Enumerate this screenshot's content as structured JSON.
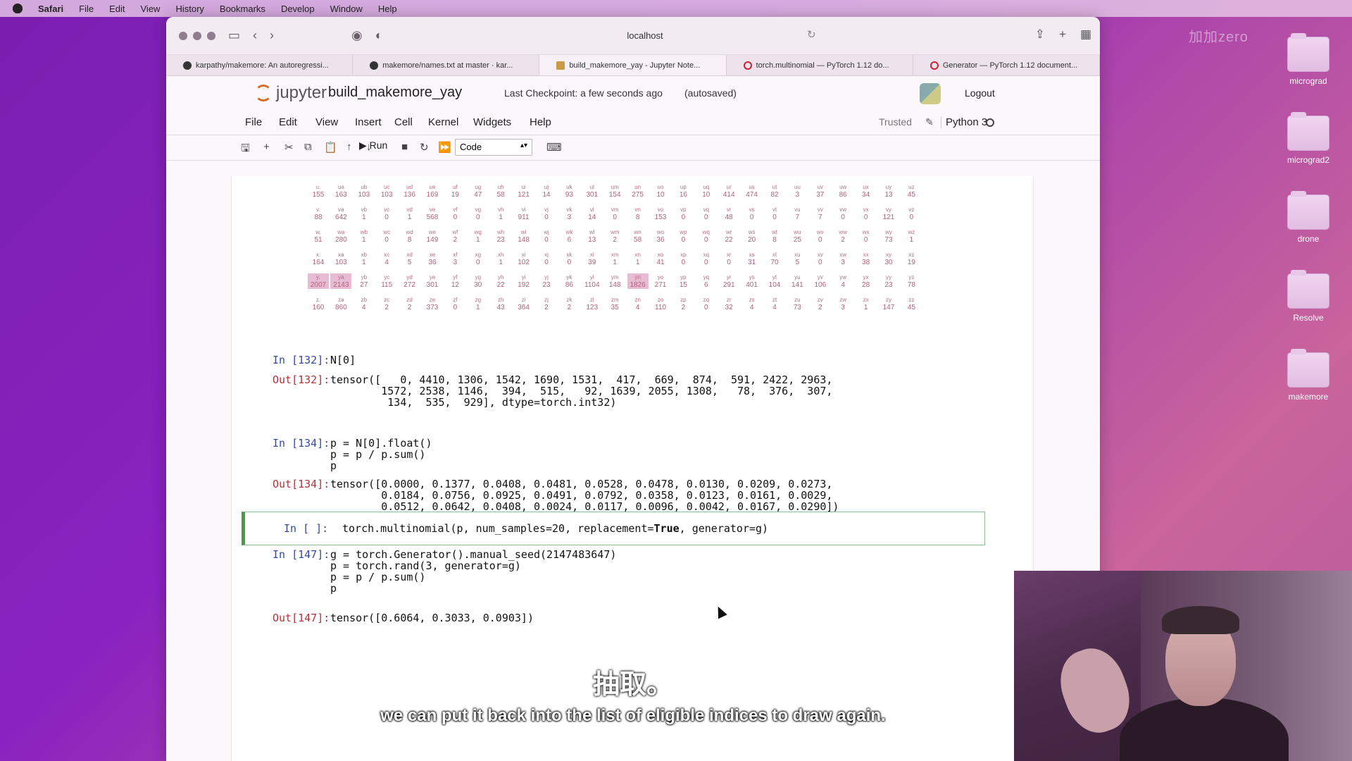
{
  "menubar": {
    "app": "Safari",
    "items": [
      "File",
      "Edit",
      "View",
      "History",
      "Bookmarks",
      "Develop",
      "Window",
      "Help"
    ]
  },
  "desktop": {
    "watermark": "加加zero",
    "icons": [
      "micrograd",
      "micrograd2",
      "drone",
      "Resolve",
      "makemore"
    ]
  },
  "browser": {
    "url": "localhost",
    "tabs": [
      {
        "label": "karpathy/makemore: An autoregressi...",
        "icon": "github-icon"
      },
      {
        "label": "makemore/names.txt at master · kar...",
        "icon": "github-icon"
      },
      {
        "label": "build_makemore_yay - Jupyter Note...",
        "icon": "jupyter-icon"
      },
      {
        "label": "torch.multinomial — PyTorch 1.12 do...",
        "icon": "pytorch-icon"
      },
      {
        "label": "Generator — PyTorch 1.12 document...",
        "icon": "pytorch-icon"
      }
    ],
    "active_tab": 2
  },
  "jupyter": {
    "logo_text": "jupyter",
    "notebook_name": "build_makemore_yay",
    "checkpoint": "Last Checkpoint: a few seconds ago",
    "autosaved": "(autosaved)",
    "logout": "Logout",
    "menu": [
      "File",
      "Edit",
      "View",
      "Insert",
      "Cell",
      "Kernel",
      "Widgets",
      "Help"
    ],
    "trusted": "Trusted",
    "kernel": "Python 3",
    "run_label": "Run",
    "cell_type": "Code"
  },
  "bigram_grid": {
    "rows": [
      {
        "labels": [
          "u.",
          "ua",
          "ub",
          "uc",
          "ud",
          "ue",
          "uf",
          "ug",
          "uh",
          "ui",
          "uj",
          "uk",
          "ul",
          "um",
          "un",
          "uo",
          "up",
          "uq",
          "ur",
          "us",
          "ut",
          "uu",
          "uv",
          "uw",
          "ux",
          "uy",
          "uz"
        ],
        "values": [
          "155",
          "163",
          "103",
          "103",
          "136",
          "169",
          "19",
          "47",
          "58",
          "121",
          "14",
          "93",
          "301",
          "154",
          "275",
          "10",
          "16",
          "10",
          "414",
          "474",
          "82",
          "3",
          "37",
          "86",
          "34",
          "13",
          "45"
        ]
      },
      {
        "labels": [
          "v.",
          "va",
          "vb",
          "vc",
          "vd",
          "ve",
          "vf",
          "vg",
          "vh",
          "vi",
          "vj",
          "vk",
          "vl",
          "vm",
          "vn",
          "vo",
          "vp",
          "vq",
          "vr",
          "vs",
          "vt",
          "vu",
          "vv",
          "vw",
          "vx",
          "vy",
          "vz"
        ],
        "values": [
          "88",
          "642",
          "1",
          "0",
          "1",
          "568",
          "0",
          "0",
          "1",
          "911",
          "0",
          "3",
          "14",
          "0",
          "8",
          "153",
          "0",
          "0",
          "48",
          "0",
          "0",
          "7",
          "7",
          "0",
          "0",
          "121",
          "0"
        ]
      },
      {
        "labels": [
          "w.",
          "wa",
          "wb",
          "wc",
          "wd",
          "we",
          "wf",
          "wg",
          "wh",
          "wi",
          "wj",
          "wk",
          "wl",
          "wm",
          "wn",
          "wo",
          "wp",
          "wq",
          "wr",
          "ws",
          "wt",
          "wu",
          "wv",
          "ww",
          "wx",
          "wy",
          "wz"
        ],
        "values": [
          "51",
          "280",
          "1",
          "0",
          "8",
          "149",
          "2",
          "1",
          "23",
          "148",
          "0",
          "6",
          "13",
          "2",
          "58",
          "36",
          "0",
          "0",
          "22",
          "20",
          "8",
          "25",
          "0",
          "2",
          "0",
          "73",
          "1"
        ]
      },
      {
        "labels": [
          "x.",
          "xa",
          "xb",
          "xc",
          "xd",
          "xe",
          "xf",
          "xg",
          "xh",
          "xi",
          "xj",
          "xk",
          "xl",
          "xm",
          "xn",
          "xo",
          "xp",
          "xq",
          "xr",
          "xs",
          "xt",
          "xu",
          "xv",
          "xw",
          "xx",
          "xy",
          "xz"
        ],
        "values": [
          "164",
          "103",
          "1",
          "4",
          "5",
          "36",
          "3",
          "0",
          "1",
          "102",
          "0",
          "0",
          "39",
          "1",
          "1",
          "41",
          "0",
          "0",
          "0",
          "31",
          "70",
          "5",
          "0",
          "3",
          "38",
          "30",
          "19"
        ]
      },
      {
        "labels": [
          "y.",
          "ya",
          "yb",
          "yc",
          "yd",
          "ye",
          "yf",
          "yg",
          "yh",
          "yi",
          "yj",
          "yk",
          "yl",
          "ym",
          "yn",
          "yo",
          "yp",
          "yq",
          "yr",
          "ys",
          "yt",
          "yu",
          "yv",
          "yw",
          "yx",
          "yy",
          "yz"
        ],
        "values": [
          "2007",
          "2143",
          "27",
          "115",
          "272",
          "301",
          "12",
          "30",
          "22",
          "192",
          "23",
          "86",
          "1104",
          "148",
          "1826",
          "271",
          "15",
          "6",
          "291",
          "401",
          "104",
          "141",
          "106",
          "4",
          "28",
          "23",
          "78"
        ]
      },
      {
        "labels": [
          "z.",
          "za",
          "zb",
          "zc",
          "zd",
          "ze",
          "zf",
          "zg",
          "zh",
          "zi",
          "zj",
          "zk",
          "zl",
          "zm",
          "zn",
          "zo",
          "zp",
          "zq",
          "zr",
          "zs",
          "zt",
          "zu",
          "zv",
          "zw",
          "zx",
          "zy",
          "zz"
        ],
        "values": [
          "160",
          "860",
          "4",
          "2",
          "2",
          "373",
          "0",
          "1",
          "43",
          "364",
          "2",
          "2",
          "123",
          "35",
          "4",
          "110",
          "2",
          "0",
          "32",
          "4",
          "4",
          "73",
          "2",
          "3",
          "1",
          "147",
          "45"
        ]
      }
    ],
    "highlight": [
      [
        4,
        0
      ],
      [
        4,
        1
      ],
      [
        4,
        14
      ]
    ]
  },
  "cells": [
    {
      "in_prompt": "In [132]:",
      "code": "N[0]",
      "out_prompt": "Out[132]:",
      "output": "tensor([   0, 4410, 1306, 1542, 1690, 1531,  417,  669,  874,  591, 2422, 2963,\n        1572, 2538, 1146,  394,  515,   92, 1639, 2055, 1308,   78,  376,  307,\n         134,  535,  929], dtype=torch.int32)"
    },
    {
      "in_prompt": "In [134]:",
      "code": "p = N[0].float()\np = p / p.sum()\np",
      "out_prompt": "Out[134]:",
      "output": "tensor([0.0000, 0.1377, 0.0408, 0.0481, 0.0528, 0.0478, 0.0130, 0.0209, 0.0273,\n        0.0184, 0.0756, 0.0925, 0.0491, 0.0792, 0.0358, 0.0123, 0.0161, 0.0029,\n        0.0512, 0.0642, 0.0408, 0.0024, 0.0117, 0.0096, 0.0042, 0.0167, 0.0290])"
    },
    {
      "in_prompt": "In [147]:",
      "code": "g = torch.Generator().manual_seed(2147483647)\np = torch.rand(3, generator=g)\np = p / p.sum()\np",
      "out_prompt": "Out[147]:",
      "output": "tensor([0.6064, 0.3033, 0.0903])"
    }
  ],
  "active_cell": {
    "in_prompt": "In [ ]:",
    "code_pre": "torch.multinomial(p, num_samples=20, replacement=",
    "code_kw": "True",
    "code_post": ", generator=g)"
  },
  "subtitles": {
    "cn": "抽取。",
    "en": "we can put it back into the list of eligible indices to draw again."
  }
}
